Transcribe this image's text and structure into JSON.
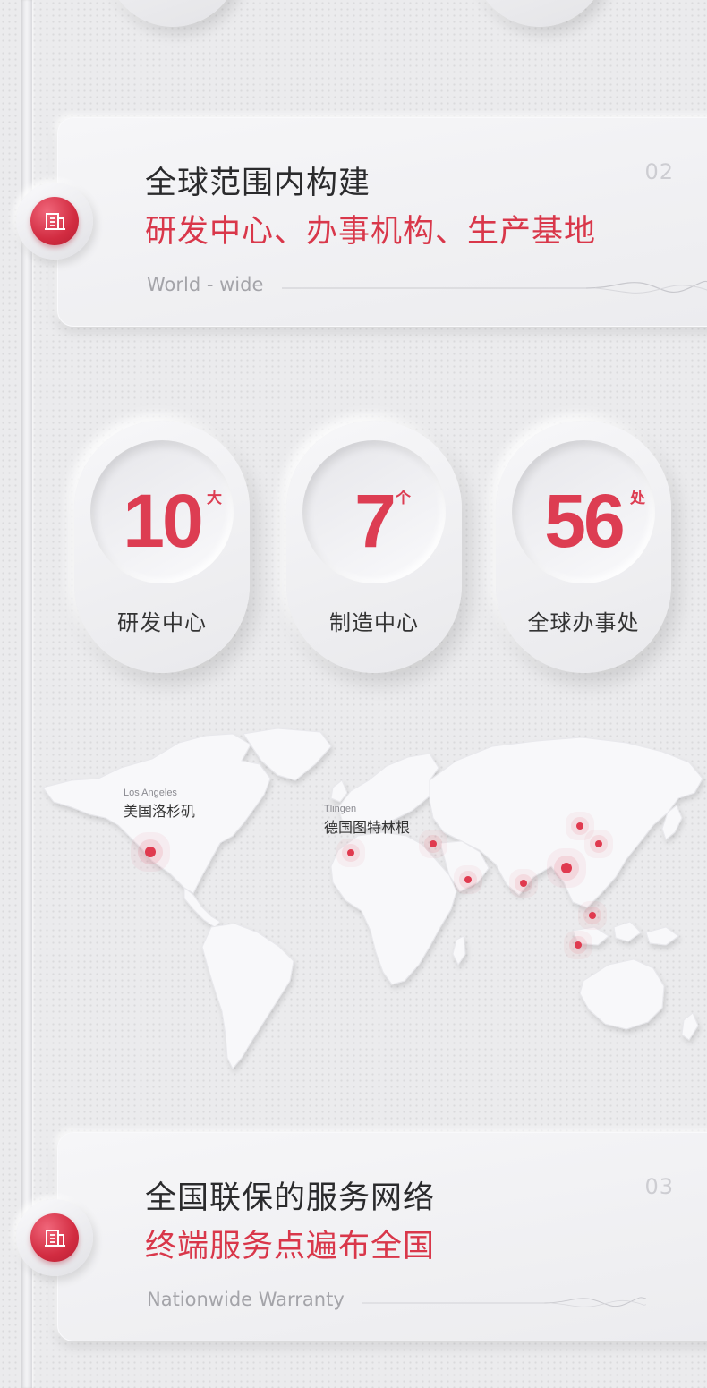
{
  "colors": {
    "accent": "#dd3d52",
    "background": "#ebebed",
    "title": "#2b2b2d",
    "muted": "#a4a4a9"
  },
  "sections": [
    {
      "number": "02",
      "title": "全球范围内构建",
      "subtitle": "研发中心、办事机构、生产基地",
      "english": "World - wide",
      "icon": "building-icon"
    },
    {
      "number": "03",
      "title": "全国联保的服务网络",
      "subtitle": "终端服务点遍布全国",
      "english": "Nationwide Warranty",
      "icon": "building-icon"
    }
  ],
  "stats": [
    {
      "value": "10",
      "unit": "大",
      "label": "研发中心"
    },
    {
      "value": "7",
      "unit": "个",
      "label": "制造中心"
    },
    {
      "value": "56",
      "unit": "处",
      "label": "全球办事处"
    }
  ],
  "map": {
    "cities": [
      {
        "en": "Los Angeles",
        "cn": "美国洛杉矶"
      },
      {
        "en": "Tlingen",
        "cn": "德国图特林根"
      }
    ]
  }
}
